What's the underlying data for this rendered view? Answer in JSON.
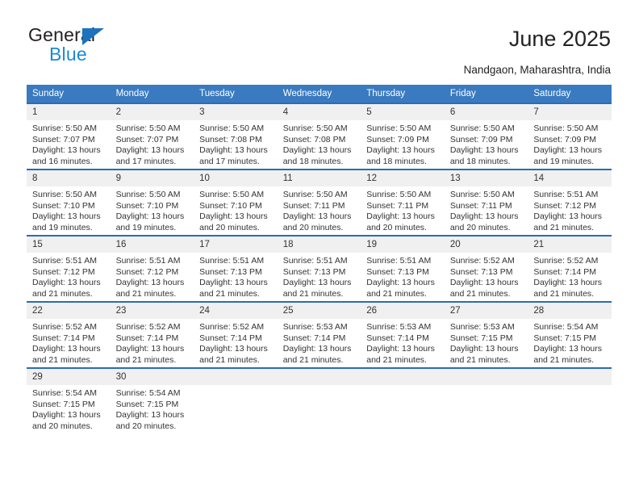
{
  "brand": {
    "name_top": "General",
    "name_bottom": "Blue",
    "accent_color": "#1c8ad6",
    "triangle_color": "#1c72bd"
  },
  "header": {
    "title": "June 2025",
    "subtitle": "Nandgaon, Maharashtra, India"
  },
  "calendar": {
    "header_bg": "#3a7ac0",
    "row_border_color": "#2a6cb5",
    "daynum_bg": "#f0f0f0",
    "weekdays": [
      "Sunday",
      "Monday",
      "Tuesday",
      "Wednesday",
      "Thursday",
      "Friday",
      "Saturday"
    ],
    "weeks": [
      [
        {
          "day": "1",
          "sunrise": "Sunrise: 5:50 AM",
          "sunset": "Sunset: 7:07 PM",
          "daylight_line1": "Daylight: 13 hours",
          "daylight_line2": "and 16 minutes."
        },
        {
          "day": "2",
          "sunrise": "Sunrise: 5:50 AM",
          "sunset": "Sunset: 7:07 PM",
          "daylight_line1": "Daylight: 13 hours",
          "daylight_line2": "and 17 minutes."
        },
        {
          "day": "3",
          "sunrise": "Sunrise: 5:50 AM",
          "sunset": "Sunset: 7:08 PM",
          "daylight_line1": "Daylight: 13 hours",
          "daylight_line2": "and 17 minutes."
        },
        {
          "day": "4",
          "sunrise": "Sunrise: 5:50 AM",
          "sunset": "Sunset: 7:08 PM",
          "daylight_line1": "Daylight: 13 hours",
          "daylight_line2": "and 18 minutes."
        },
        {
          "day": "5",
          "sunrise": "Sunrise: 5:50 AM",
          "sunset": "Sunset: 7:09 PM",
          "daylight_line1": "Daylight: 13 hours",
          "daylight_line2": "and 18 minutes."
        },
        {
          "day": "6",
          "sunrise": "Sunrise: 5:50 AM",
          "sunset": "Sunset: 7:09 PM",
          "daylight_line1": "Daylight: 13 hours",
          "daylight_line2": "and 18 minutes."
        },
        {
          "day": "7",
          "sunrise": "Sunrise: 5:50 AM",
          "sunset": "Sunset: 7:09 PM",
          "daylight_line1": "Daylight: 13 hours",
          "daylight_line2": "and 19 minutes."
        }
      ],
      [
        {
          "day": "8",
          "sunrise": "Sunrise: 5:50 AM",
          "sunset": "Sunset: 7:10 PM",
          "daylight_line1": "Daylight: 13 hours",
          "daylight_line2": "and 19 minutes."
        },
        {
          "day": "9",
          "sunrise": "Sunrise: 5:50 AM",
          "sunset": "Sunset: 7:10 PM",
          "daylight_line1": "Daylight: 13 hours",
          "daylight_line2": "and 19 minutes."
        },
        {
          "day": "10",
          "sunrise": "Sunrise: 5:50 AM",
          "sunset": "Sunset: 7:10 PM",
          "daylight_line1": "Daylight: 13 hours",
          "daylight_line2": "and 20 minutes."
        },
        {
          "day": "11",
          "sunrise": "Sunrise: 5:50 AM",
          "sunset": "Sunset: 7:11 PM",
          "daylight_line1": "Daylight: 13 hours",
          "daylight_line2": "and 20 minutes."
        },
        {
          "day": "12",
          "sunrise": "Sunrise: 5:50 AM",
          "sunset": "Sunset: 7:11 PM",
          "daylight_line1": "Daylight: 13 hours",
          "daylight_line2": "and 20 minutes."
        },
        {
          "day": "13",
          "sunrise": "Sunrise: 5:50 AM",
          "sunset": "Sunset: 7:11 PM",
          "daylight_line1": "Daylight: 13 hours",
          "daylight_line2": "and 20 minutes."
        },
        {
          "day": "14",
          "sunrise": "Sunrise: 5:51 AM",
          "sunset": "Sunset: 7:12 PM",
          "daylight_line1": "Daylight: 13 hours",
          "daylight_line2": "and 21 minutes."
        }
      ],
      [
        {
          "day": "15",
          "sunrise": "Sunrise: 5:51 AM",
          "sunset": "Sunset: 7:12 PM",
          "daylight_line1": "Daylight: 13 hours",
          "daylight_line2": "and 21 minutes."
        },
        {
          "day": "16",
          "sunrise": "Sunrise: 5:51 AM",
          "sunset": "Sunset: 7:12 PM",
          "daylight_line1": "Daylight: 13 hours",
          "daylight_line2": "and 21 minutes."
        },
        {
          "day": "17",
          "sunrise": "Sunrise: 5:51 AM",
          "sunset": "Sunset: 7:13 PM",
          "daylight_line1": "Daylight: 13 hours",
          "daylight_line2": "and 21 minutes."
        },
        {
          "day": "18",
          "sunrise": "Sunrise: 5:51 AM",
          "sunset": "Sunset: 7:13 PM",
          "daylight_line1": "Daylight: 13 hours",
          "daylight_line2": "and 21 minutes."
        },
        {
          "day": "19",
          "sunrise": "Sunrise: 5:51 AM",
          "sunset": "Sunset: 7:13 PM",
          "daylight_line1": "Daylight: 13 hours",
          "daylight_line2": "and 21 minutes."
        },
        {
          "day": "20",
          "sunrise": "Sunrise: 5:52 AM",
          "sunset": "Sunset: 7:13 PM",
          "daylight_line1": "Daylight: 13 hours",
          "daylight_line2": "and 21 minutes."
        },
        {
          "day": "21",
          "sunrise": "Sunrise: 5:52 AM",
          "sunset": "Sunset: 7:14 PM",
          "daylight_line1": "Daylight: 13 hours",
          "daylight_line2": "and 21 minutes."
        }
      ],
      [
        {
          "day": "22",
          "sunrise": "Sunrise: 5:52 AM",
          "sunset": "Sunset: 7:14 PM",
          "daylight_line1": "Daylight: 13 hours",
          "daylight_line2": "and 21 minutes."
        },
        {
          "day": "23",
          "sunrise": "Sunrise: 5:52 AM",
          "sunset": "Sunset: 7:14 PM",
          "daylight_line1": "Daylight: 13 hours",
          "daylight_line2": "and 21 minutes."
        },
        {
          "day": "24",
          "sunrise": "Sunrise: 5:52 AM",
          "sunset": "Sunset: 7:14 PM",
          "daylight_line1": "Daylight: 13 hours",
          "daylight_line2": "and 21 minutes."
        },
        {
          "day": "25",
          "sunrise": "Sunrise: 5:53 AM",
          "sunset": "Sunset: 7:14 PM",
          "daylight_line1": "Daylight: 13 hours",
          "daylight_line2": "and 21 minutes."
        },
        {
          "day": "26",
          "sunrise": "Sunrise: 5:53 AM",
          "sunset": "Sunset: 7:14 PM",
          "daylight_line1": "Daylight: 13 hours",
          "daylight_line2": "and 21 minutes."
        },
        {
          "day": "27",
          "sunrise": "Sunrise: 5:53 AM",
          "sunset": "Sunset: 7:15 PM",
          "daylight_line1": "Daylight: 13 hours",
          "daylight_line2": "and 21 minutes."
        },
        {
          "day": "28",
          "sunrise": "Sunrise: 5:54 AM",
          "sunset": "Sunset: 7:15 PM",
          "daylight_line1": "Daylight: 13 hours",
          "daylight_line2": "and 21 minutes."
        }
      ],
      [
        {
          "day": "29",
          "sunrise": "Sunrise: 5:54 AM",
          "sunset": "Sunset: 7:15 PM",
          "daylight_line1": "Daylight: 13 hours",
          "daylight_line2": "and 20 minutes."
        },
        {
          "day": "30",
          "sunrise": "Sunrise: 5:54 AM",
          "sunset": "Sunset: 7:15 PM",
          "daylight_line1": "Daylight: 13 hours",
          "daylight_line2": "and 20 minutes."
        },
        {
          "day": "",
          "sunrise": "",
          "sunset": "",
          "daylight_line1": "",
          "daylight_line2": ""
        },
        {
          "day": "",
          "sunrise": "",
          "sunset": "",
          "daylight_line1": "",
          "daylight_line2": ""
        },
        {
          "day": "",
          "sunrise": "",
          "sunset": "",
          "daylight_line1": "",
          "daylight_line2": ""
        },
        {
          "day": "",
          "sunrise": "",
          "sunset": "",
          "daylight_line1": "",
          "daylight_line2": ""
        },
        {
          "day": "",
          "sunrise": "",
          "sunset": "",
          "daylight_line1": "",
          "daylight_line2": ""
        }
      ]
    ]
  }
}
